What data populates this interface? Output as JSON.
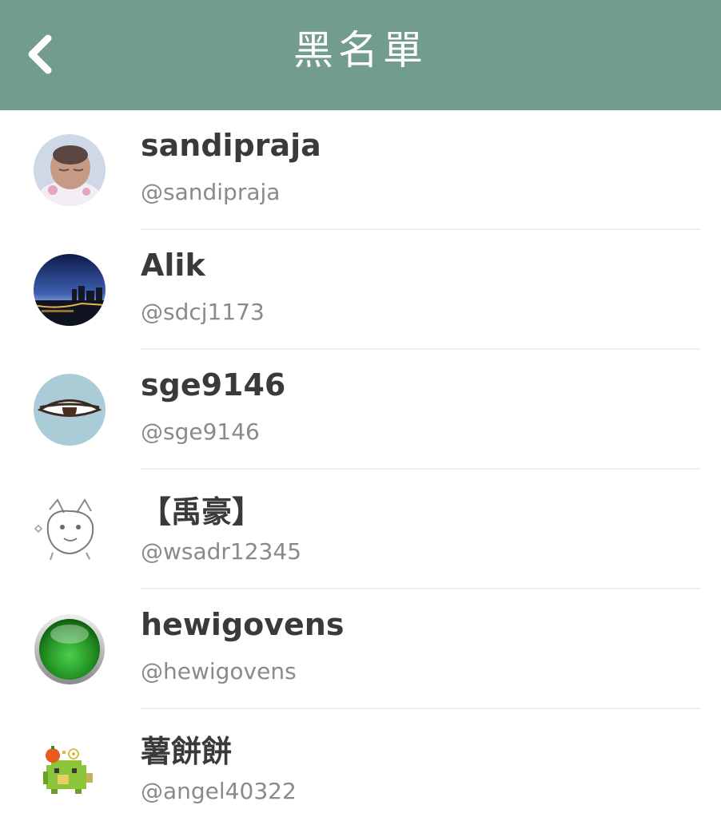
{
  "header": {
    "title": "黑名單",
    "back_icon": "chevron-left-icon",
    "background_color": "#729c8c"
  },
  "blocked_users": [
    {
      "name": "sandipraja",
      "handle": "@sandipraja",
      "avatar": "baby-photo"
    },
    {
      "name": "Alik",
      "handle": "@sdcj1173",
      "avatar": "night-city-skyline-photo"
    },
    {
      "name": "sge9146",
      "handle": "@sge9146",
      "avatar": "sleepy-eye-drawing"
    },
    {
      "name": "【禹豪】",
      "handle": "@wsadr12345",
      "avatar": "wolf-sketch-drawing"
    },
    {
      "name": "hewigovens",
      "handle": "@hewigovens",
      "avatar": "green-ball-icon"
    },
    {
      "name": "薯餅餅",
      "handle": "@angel40322",
      "avatar": "pixel-creature-drawing"
    }
  ]
}
